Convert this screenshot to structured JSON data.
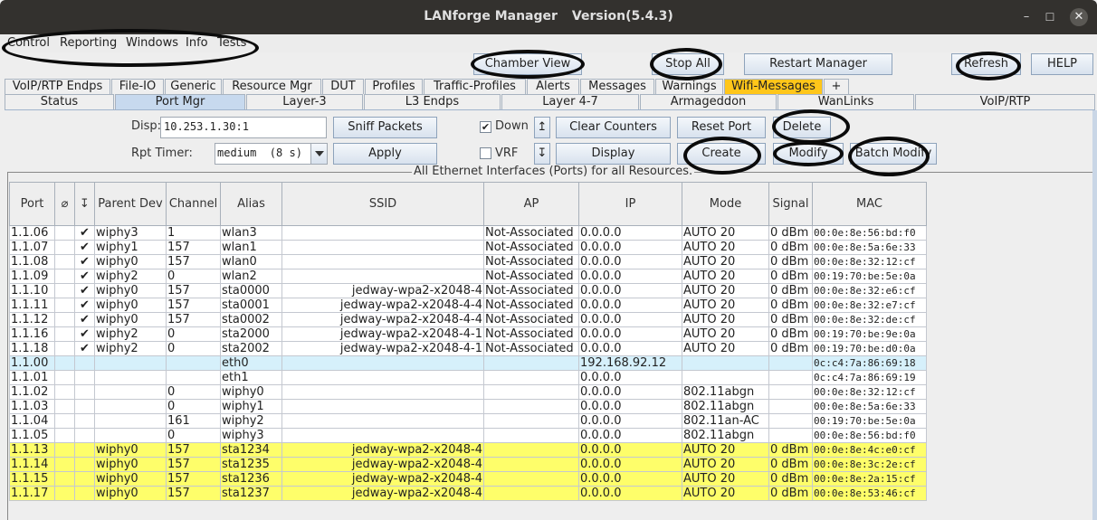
{
  "window": {
    "app_title": "LANforge Manager",
    "version": "Version(5.4.3)",
    "controls": {
      "minimize": "–",
      "maximize": "☐",
      "close": "✕"
    }
  },
  "menubar": [
    {
      "label": "Control",
      "mnemonic": "C"
    },
    {
      "label": "Reporting",
      "mnemonic": "R"
    },
    {
      "label": "Windows",
      "mnemonic": "o"
    },
    {
      "label": "Info",
      "mnemonic": "I"
    },
    {
      "label": "Tests",
      "mnemonic": "T"
    }
  ],
  "toolbar": {
    "chamber_view": "Chamber View",
    "stop_all": "Stop All",
    "restart_manager": "Restart Manager",
    "refresh": "Refresh",
    "help": "HELP"
  },
  "tabs_row1": [
    {
      "label": "VoIP/RTP Endps"
    },
    {
      "label": "File-IO"
    },
    {
      "label": "Generic"
    },
    {
      "label": "Resource Mgr"
    },
    {
      "label": "DUT"
    },
    {
      "label": "Profiles"
    },
    {
      "label": "Traffic-Profiles"
    },
    {
      "label": "Alerts"
    },
    {
      "label": "Messages"
    },
    {
      "label": "Warnings"
    },
    {
      "label": "Wifi-Messages",
      "highlighted": true
    },
    {
      "label": "+"
    }
  ],
  "tabs_row2": [
    {
      "label": "Status"
    },
    {
      "label": "Port Mgr",
      "selected": true
    },
    {
      "label": "Layer-3"
    },
    {
      "label": "L3 Endps"
    },
    {
      "label": "Layer 4-7"
    },
    {
      "label": "Armageddon"
    },
    {
      "label": "WanLinks"
    },
    {
      "label": "VoIP/RTP"
    }
  ],
  "controls": {
    "disp_label": "Disp:",
    "disp_value": "10.253.1.30:1",
    "rpt_timer_label": "Rpt Timer:",
    "rpt_timer_value": "medium  (8 s)",
    "sniff_packets": "Sniff Packets",
    "apply": "Apply",
    "down_label": "Down",
    "down_checked": true,
    "vrf_label": "VRF",
    "vrf_checked": false,
    "sort_up": "↥",
    "sort_down": "↧",
    "clear_counters": "Clear Counters",
    "display": "Display",
    "reset_port": "Reset Port",
    "create": "Create",
    "delete": "Delete",
    "modify": "Modify",
    "batch_modify": "Batch Modify"
  },
  "panel": {
    "title": "All Ethernet Interfaces (Ports) for all Resources."
  },
  "table": {
    "columns": [
      "Port",
      "⌀",
      "↧",
      "Parent Dev",
      "Channel",
      "Alias",
      "SSID",
      "AP",
      "IP",
      "Mode",
      "Signal",
      "MAC"
    ],
    "rows": [
      {
        "style": "",
        "cells": [
          "1.1.06",
          "",
          "✔",
          "wiphy3",
          "1",
          "wlan3",
          "",
          "Not-Associated",
          "0.0.0.0",
          "AUTO 20",
          "0 dBm",
          "00:0e:8e:56:bd:f0"
        ]
      },
      {
        "style": "",
        "cells": [
          "1.1.07",
          "",
          "✔",
          "wiphy1",
          "157",
          "wlan1",
          "",
          "Not-Associated",
          "0.0.0.0",
          "AUTO 20",
          "0 dBm",
          "00:0e:8e:5a:6e:33"
        ]
      },
      {
        "style": "",
        "cells": [
          "1.1.08",
          "",
          "✔",
          "wiphy0",
          "157",
          "wlan0",
          "",
          "Not-Associated",
          "0.0.0.0",
          "AUTO 20",
          "0 dBm",
          "00:0e:8e:32:12:cf"
        ]
      },
      {
        "style": "",
        "cells": [
          "1.1.09",
          "",
          "✔",
          "wiphy2",
          "0",
          "wlan2",
          "",
          "Not-Associated",
          "0.0.0.0",
          "AUTO 20",
          "0 dBm",
          "00:19:70:be:5e:0a"
        ]
      },
      {
        "style": "",
        "cells": [
          "1.1.10",
          "",
          "✔",
          "wiphy0",
          "157",
          "sta0000",
          "jedway-wpa2-x2048-4",
          "Not-Associated",
          "0.0.0.0",
          "AUTO 20",
          "0 dBm",
          "00:0e:8e:32:e6:cf"
        ]
      },
      {
        "style": "",
        "cells": [
          "1.1.11",
          "",
          "✔",
          "wiphy0",
          "157",
          "sta0001",
          "jedway-wpa2-x2048-4-4",
          "Not-Associated",
          "0.0.0.0",
          "AUTO 20",
          "0 dBm",
          "00:0e:8e:32:e7:cf"
        ]
      },
      {
        "style": "",
        "cells": [
          "1.1.12",
          "",
          "✔",
          "wiphy0",
          "157",
          "sta0002",
          "jedway-wpa2-x2048-4-4",
          "Not-Associated",
          "0.0.0.0",
          "AUTO 20",
          "0 dBm",
          "00:0e:8e:32:de:cf"
        ]
      },
      {
        "style": "",
        "cells": [
          "1.1.16",
          "",
          "✔",
          "wiphy2",
          "0",
          "sta2000",
          "jedway-wpa2-x2048-4-1",
          "Not-Associated",
          "0.0.0.0",
          "AUTO 20",
          "0 dBm",
          "00:19:70:be:9e:0a"
        ]
      },
      {
        "style": "",
        "cells": [
          "1.1.18",
          "",
          "✔",
          "wiphy2",
          "0",
          "sta2002",
          "jedway-wpa2-x2048-4-1",
          "Not-Associated",
          "0.0.0.0",
          "AUTO 20",
          "0 dBm",
          "00:19:70:be:d0:0a"
        ]
      },
      {
        "style": "sel",
        "cells": [
          "1.1.00",
          "",
          "",
          "",
          "",
          "eth0",
          "",
          "",
          "192.168.92.12",
          "",
          "",
          "0c:c4:7a:86:69:18"
        ]
      },
      {
        "style": "",
        "cells": [
          "1.1.01",
          "",
          "",
          "",
          "",
          "eth1",
          "",
          "",
          "0.0.0.0",
          "",
          "",
          "0c:c4:7a:86:69:19"
        ]
      },
      {
        "style": "",
        "cells": [
          "1.1.02",
          "",
          "",
          "",
          "0",
          "wiphy0",
          "",
          "",
          "0.0.0.0",
          "802.11abgn",
          "",
          "00:0e:8e:32:12:cf"
        ]
      },
      {
        "style": "",
        "cells": [
          "1.1.03",
          "",
          "",
          "",
          "0",
          "wiphy1",
          "",
          "",
          "0.0.0.0",
          "802.11abgn",
          "",
          "00:0e:8e:5a:6e:33"
        ]
      },
      {
        "style": "",
        "cells": [
          "1.1.04",
          "",
          "",
          "",
          "161",
          "wiphy2",
          "",
          "",
          "0.0.0.0",
          "802.11an-AC",
          "",
          "00:19:70:be:5e:0a"
        ]
      },
      {
        "style": "",
        "cells": [
          "1.1.05",
          "",
          "",
          "",
          "0",
          "wiphy3",
          "",
          "",
          "0.0.0.0",
          "802.11abgn",
          "",
          "00:0e:8e:56:bd:f0"
        ]
      },
      {
        "style": "yellow",
        "cells": [
          "1.1.13",
          "",
          "",
          "wiphy0",
          "157",
          "sta1234",
          "jedway-wpa2-x2048-4",
          "",
          "0.0.0.0",
          "AUTO 20",
          "0 dBm",
          "00:0e:8e:4c:e0:cf"
        ]
      },
      {
        "style": "yellow",
        "cells": [
          "1.1.14",
          "",
          "",
          "wiphy0",
          "157",
          "sta1235",
          "jedway-wpa2-x2048-4",
          "",
          "0.0.0.0",
          "AUTO 20",
          "0 dBm",
          "00:0e:8e:3c:2e:cf"
        ]
      },
      {
        "style": "yellow",
        "cells": [
          "1.1.15",
          "",
          "",
          "wiphy0",
          "157",
          "sta1236",
          "jedway-wpa2-x2048-4",
          "",
          "0.0.0.0",
          "AUTO 20",
          "0 dBm",
          "00:0e:8e:2a:15:cf"
        ]
      },
      {
        "style": "yellow",
        "cells": [
          "1.1.17",
          "",
          "",
          "wiphy0",
          "157",
          "sta1237",
          "jedway-wpa2-x2048-4",
          "",
          "0.0.0.0",
          "AUTO 20",
          "0 dBm",
          "00:0e:8e:53:46:cf"
        ]
      }
    ]
  },
  "colors": {
    "selected_tab": "#c7d9ee",
    "alert_tab": "#ffc61a",
    "selected_row": "#d6f0fb",
    "highlight_row": "#fefe6a",
    "annotation_ellipse": "#0b0b0b"
  }
}
